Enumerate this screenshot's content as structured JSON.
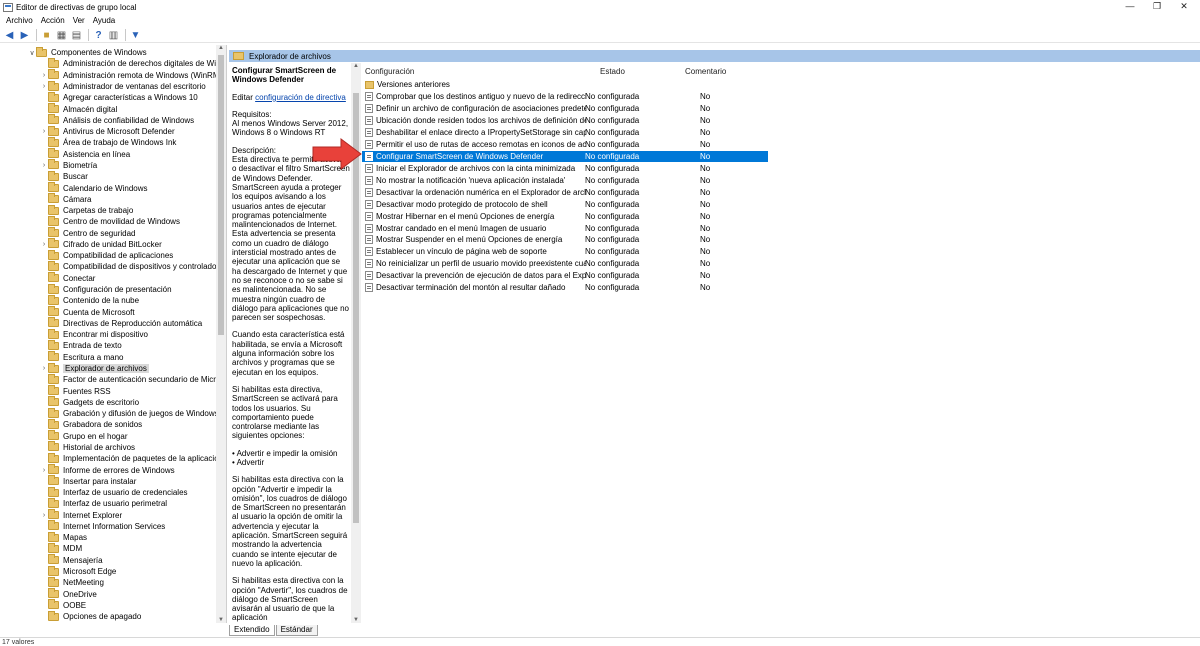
{
  "window": {
    "title": "Editor de directivas de grupo local",
    "minimize": "—",
    "maximize": "❐",
    "close": "✕"
  },
  "menu": [
    "Archivo",
    "Acción",
    "Ver",
    "Ayuda"
  ],
  "toolbar": {
    "icons": [
      "back-icon",
      "forward-icon",
      "up-folder-icon",
      "show-hide-tree-icon",
      "export-list-icon",
      "help-icon",
      "properties-icon",
      "filter-icon"
    ]
  },
  "tree": {
    "root": "Componentes de Windows",
    "items": [
      {
        "label": "Administración de derechos digitales de Windo",
        "expandable": false
      },
      {
        "label": "Administración remota de Windows (WinRM)",
        "expandable": true
      },
      {
        "label": "Administrador de ventanas del escritorio",
        "expandable": true
      },
      {
        "label": "Agregar características a Windows 10",
        "expandable": false
      },
      {
        "label": "Almacén digital",
        "expandable": false
      },
      {
        "label": "Análisis de confiabilidad de Windows",
        "expandable": false
      },
      {
        "label": "Antivirus de Microsoft Defender",
        "expandable": true
      },
      {
        "label": "Área de trabajo de Windows Ink",
        "expandable": false
      },
      {
        "label": "Asistencia en línea",
        "expandable": false
      },
      {
        "label": "Biometría",
        "expandable": true
      },
      {
        "label": "Buscar",
        "expandable": false
      },
      {
        "label": "Calendario de Windows",
        "expandable": false
      },
      {
        "label": "Cámara",
        "expandable": false
      },
      {
        "label": "Carpetas de trabajo",
        "expandable": false
      },
      {
        "label": "Centro de movilidad de Windows",
        "expandable": false
      },
      {
        "label": "Centro de seguridad",
        "expandable": false
      },
      {
        "label": "Cifrado de unidad BitLocker",
        "expandable": true
      },
      {
        "label": "Compatibilidad de aplicaciones",
        "expandable": false
      },
      {
        "label": "Compatibilidad de dispositivos y controladore",
        "expandable": false
      },
      {
        "label": "Conectar",
        "expandable": false
      },
      {
        "label": "Configuración de presentación",
        "expandable": false
      },
      {
        "label": "Contenido de la nube",
        "expandable": false
      },
      {
        "label": "Cuenta de Microsoft",
        "expandable": false
      },
      {
        "label": "Directivas de Reproducción automática",
        "expandable": false
      },
      {
        "label": "Encontrar mi dispositivo",
        "expandable": false
      },
      {
        "label": "Entrada de texto",
        "expandable": false
      },
      {
        "label": "Escritura a mano",
        "expandable": false
      },
      {
        "label": "Explorador de archivos",
        "expandable": true,
        "selected": true
      },
      {
        "label": "Factor de autenticación secundario de Micros",
        "expandable": false
      },
      {
        "label": "Fuentes RSS",
        "expandable": false
      },
      {
        "label": "Gadgets de escritorio",
        "expandable": false
      },
      {
        "label": "Grabación y difusión de juegos de Windows",
        "expandable": false
      },
      {
        "label": "Grabadora de sonidos",
        "expandable": false
      },
      {
        "label": "Grupo en el hogar",
        "expandable": false
      },
      {
        "label": "Historial de archivos",
        "expandable": false
      },
      {
        "label": "Implementación de paquetes de la aplicación",
        "expandable": false
      },
      {
        "label": "Informe de errores de Windows",
        "expandable": true
      },
      {
        "label": "Insertar para instalar",
        "expandable": false
      },
      {
        "label": "Interfaz de usuario de credenciales",
        "expandable": false
      },
      {
        "label": "Interfaz de usuario perimetral",
        "expandable": false
      },
      {
        "label": "Internet Explorer",
        "expandable": true
      },
      {
        "label": "Internet Information Services",
        "expandable": false
      },
      {
        "label": "Mapas",
        "expandable": false
      },
      {
        "label": "MDM",
        "expandable": false
      },
      {
        "label": "Mensajería",
        "expandable": false
      },
      {
        "label": "Microsoft Edge",
        "expandable": false
      },
      {
        "label": "NetMeeting",
        "expandable": false
      },
      {
        "label": "OneDrive",
        "expandable": false
      },
      {
        "label": "OOBE",
        "expandable": false
      },
      {
        "label": "Opciones de apagado",
        "expandable": false
      }
    ]
  },
  "right_header": "Explorador de archivos",
  "description": {
    "title": "Configurar SmartScreen de Windows Defender",
    "edit_prefix": "Editar",
    "edit_link": "configuración de directiva",
    "requirements_label": "Requisitos:",
    "requirements": "Al menos Windows Server 2012, Windows 8 o Windows RT",
    "description_label": "Descripción:",
    "paragraphs": [
      "Esta directiva te permite activar o desactivar el filtro SmartScreen de Windows Defender. SmartScreen ayuda a proteger los equipos avisando a los usuarios antes de ejecutar programas potencialmente malintencionados de Internet. Esta advertencia se presenta como un cuadro de diálogo intersticial mostrado antes de ejecutar una aplicación que se ha descargado de Internet y que no se reconoce o no se sabe si es malintencionada. No se muestra ningún cuadro de diálogo para aplicaciones que no parecen ser sospechosas.",
      "Cuando esta característica está habilitada, se envía a Microsoft alguna información sobre los archivos y programas que se ejecutan en los equipos.",
      "Si habilitas esta directiva, SmartScreen se activará para todos los usuarios. Su comportamiento puede controlarse mediante las siguientes opciones:",
      "• Advertir e impedir la omisión\n• Advertir",
      "Si habilitas esta directiva con la opción \"Advertir e impedir la omisión\", los cuadros de diálogo de SmartScreen no presentarán al usuario la opción de omitir la advertencia y ejecutar la aplicación. SmartScreen seguirá mostrando la advertencia cuando se intente ejecutar de nuevo la aplicación.",
      "Si habilitas esta directiva con la opción \"Advertir\", los cuadros de diálogo de SmartScreen avisarán al usuario de que la aplicación"
    ]
  },
  "list": {
    "headers": {
      "setting": "Configuración",
      "state": "Estado",
      "comment": "Comentario"
    },
    "folder": "Versiones anteriores",
    "rows": [
      {
        "setting": "Comprobar que los destinos antiguo y nuevo de la redirecci...",
        "state": "No configurada",
        "comment": "No"
      },
      {
        "setting": "Definir un archivo de configuración de asociaciones predete...",
        "state": "No configurada",
        "comment": "No"
      },
      {
        "setting": "Ubicación donde residen todos los archivos de definición de...",
        "state": "No configurada",
        "comment": "No"
      },
      {
        "setting": "Deshabilitar el enlace directo a IPropertySetStorage sin capa...",
        "state": "No configurada",
        "comment": "No"
      },
      {
        "setting": "Permitir el uso de rutas de acceso remotas en iconos de acc...",
        "state": "No configurada",
        "comment": "No"
      },
      {
        "setting": "Configurar SmartScreen de Windows Defender",
        "state": "No configurada",
        "comment": "No",
        "selected": true
      },
      {
        "setting": "Iniciar el Explorador de archivos con la cinta minimizada",
        "state": "No configurada",
        "comment": "No"
      },
      {
        "setting": "No mostrar la notificación 'nueva aplicación instalada'",
        "state": "No configurada",
        "comment": "No"
      },
      {
        "setting": "Desactivar la ordenación numérica en el Explorador de archi...",
        "state": "No configurada",
        "comment": "No"
      },
      {
        "setting": "Desactivar modo protegido de protocolo de shell",
        "state": "No configurada",
        "comment": "No"
      },
      {
        "setting": "Mostrar Hibernar en el menú Opciones de energía",
        "state": "No configurada",
        "comment": "No"
      },
      {
        "setting": "Mostrar candado en el menú Imagen de usuario",
        "state": "No configurada",
        "comment": "No"
      },
      {
        "setting": "Mostrar Suspender en el menú Opciones de energía",
        "state": "No configurada",
        "comment": "No"
      },
      {
        "setting": "Establecer un vínculo de página web de soporte",
        "state": "No configurada",
        "comment": "No"
      },
      {
        "setting": "No reinicializar un perfil de usuario movido preexistente cua...",
        "state": "No configurada",
        "comment": "No"
      },
      {
        "setting": "Desactivar la prevención de ejecución de datos para el Explo...",
        "state": "No configurada",
        "comment": "No"
      },
      {
        "setting": "Desactivar terminación del montón al resultar dañado",
        "state": "No configurada",
        "comment": "No"
      }
    ]
  },
  "tabs": [
    {
      "label": "Extendido",
      "active": true
    },
    {
      "label": "Estándar",
      "active": false
    }
  ],
  "status": "17 valores",
  "colors": {
    "selection": "#0078d7",
    "header": "#a7c5e8",
    "arrow": "#e8413a"
  }
}
